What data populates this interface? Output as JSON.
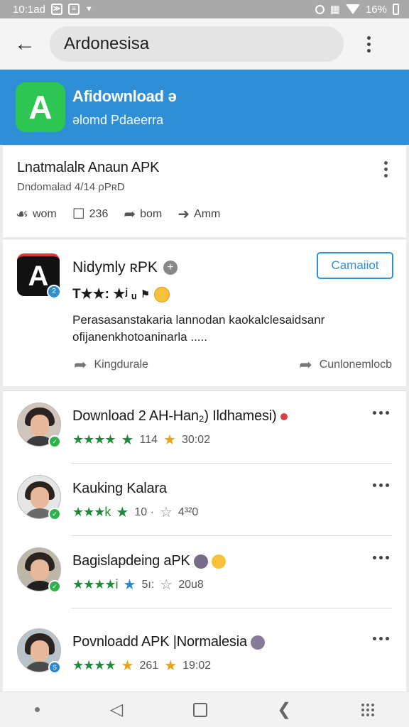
{
  "status_bar": {
    "time": "10:1ad",
    "battery": "16%"
  },
  "search": {
    "query": "Ardonesisa"
  },
  "banner": {
    "logo_letter": "A",
    "title": "Afidownload ə",
    "subtitle": "əlomd Pdaeerra"
  },
  "card1": {
    "title": "Lnatmalalʀ Anaun APK",
    "subtitle": "Dndomalad 4/14 ρPʀD",
    "actions": [
      {
        "icon": "like-icon",
        "label": "wom"
      },
      {
        "icon": "comment-icon",
        "label": "236"
      },
      {
        "icon": "share-icon",
        "label": "bom"
      },
      {
        "icon": "forward-icon",
        "label": "Amm"
      }
    ]
  },
  "app_card": {
    "icon_letter": "A",
    "badge": "2",
    "name": "Nidymly ʀPK",
    "install_label": "Camaiiot",
    "rating_text": "T★★: ★ʲ ᵤ",
    "rating_extra": "⚑",
    "description": "Perasasanstakaria lannodan kaokalclesaidsanr ofijanenkhotoaninarla .....",
    "share_left": "Kingdurale",
    "share_right": "Cunlonemlocb"
  },
  "list": [
    {
      "title": "Download 2 AH-Han₂) Ildhamesi)",
      "stars": "★★★★",
      "s1": "★",
      "s1_type": "green",
      "count1": "114",
      "s2": "★",
      "s2_type": "amber",
      "count2": "30:02",
      "badge": "✓",
      "badge_color": "#2fb04d"
    },
    {
      "title": "Kauking Kalara",
      "stars": "★★★k",
      "s1": "★",
      "s1_type": "green",
      "count1": "10 ·",
      "s2": "☆",
      "s2_type": "outline",
      "count2": "4³²0",
      "badge": "✓",
      "badge_color": "#2fb04d"
    },
    {
      "title": "Bagislapdeing aPK",
      "stars": "★★★★i",
      "s1": "★",
      "s1_type": "blue",
      "count1": "5ı:",
      "s2": "☆",
      "s2_type": "outline",
      "count2": "20u8",
      "badge": "✓",
      "badge_color": "#2fb04d"
    },
    {
      "title": "Povnloadd APK |Normalesia",
      "stars": "★★★★",
      "s1": "★",
      "s1_type": "amber",
      "count1": "261",
      "s2": "★",
      "s2_type": "amber",
      "count2": "19:02",
      "badge": "S",
      "badge_color": "#2b86d4"
    }
  ],
  "colors": {
    "accent": "#2f8fd6",
    "banner_logo": "#2dc653",
    "status_green": "#2fb04d"
  }
}
